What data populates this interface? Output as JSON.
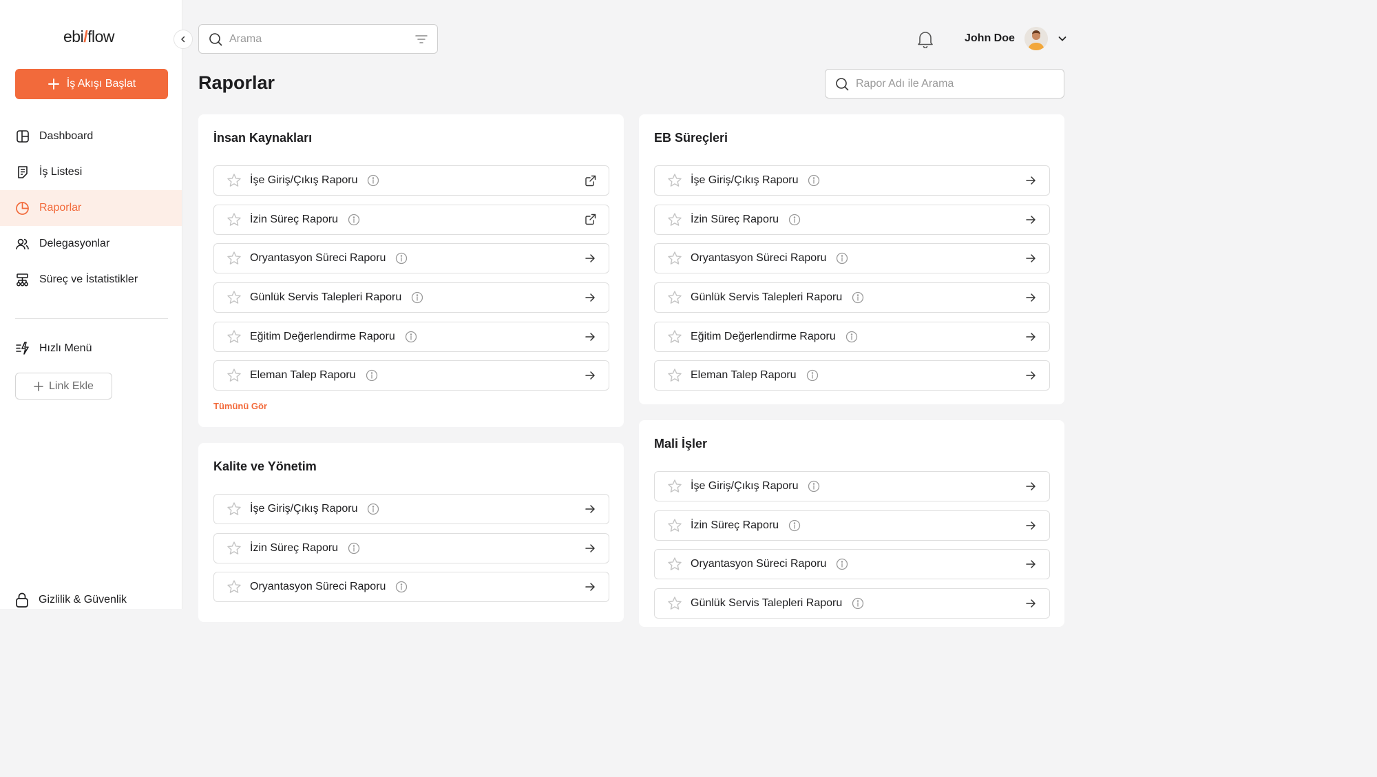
{
  "brand": {
    "logo_left": "ebi",
    "logo_slash": "/",
    "logo_right": "flow"
  },
  "sidebar": {
    "start_button": "İş Akışı Başlat",
    "items": [
      {
        "label": "Dashboard",
        "icon": "dashboard-icon",
        "active": false
      },
      {
        "label": "İş Listesi",
        "icon": "task-list-icon",
        "active": false
      },
      {
        "label": "Raporlar",
        "icon": "pie-chart-icon",
        "active": true
      },
      {
        "label": "Delegasyonlar",
        "icon": "users-icon",
        "active": false
      },
      {
        "label": "Süreç ve İstatistikler",
        "icon": "hierarchy-icon",
        "active": false
      }
    ],
    "quick_menu": "Hızlı Menü",
    "link_add": "Link Ekle",
    "privacy": "Gizlilik & Güvenlik"
  },
  "header": {
    "search_placeholder": "Arama",
    "user_name": "John Doe"
  },
  "page": {
    "title": "Raporlar",
    "report_search_placeholder": "Rapor Adı ile Arama"
  },
  "colors": {
    "accent": "#f26a3b",
    "accent_light": "#fdeee7",
    "background": "#f4f4f5"
  },
  "cards": {
    "hr": {
      "title": "İnsan Kaynakları",
      "see_all": "Tümünü Gör",
      "reports": [
        {
          "label": "İşe Giriş/Çıkış Raporu",
          "action": "external-link-icon"
        },
        {
          "label": "İzin Süreç Raporu",
          "action": "external-link-icon"
        },
        {
          "label": "Oryantasyon Süreci Raporu",
          "action": "arrow-right-icon"
        },
        {
          "label": "Günlük Servis Talepleri Raporu",
          "action": "arrow-right-icon"
        },
        {
          "label": "Eğitim Değerlendirme Raporu",
          "action": "arrow-right-icon"
        },
        {
          "label": "Eleman Talep Raporu",
          "action": "arrow-right-icon"
        }
      ]
    },
    "eb": {
      "title": "EB Süreçleri",
      "reports": [
        {
          "label": "İşe Giriş/Çıkış Raporu",
          "action": "arrow-right-icon"
        },
        {
          "label": "İzin Süreç Raporu",
          "action": "arrow-right-icon"
        },
        {
          "label": "Oryantasyon Süreci Raporu",
          "action": "arrow-right-icon"
        },
        {
          "label": "Günlük Servis Talepleri Raporu",
          "action": "arrow-right-icon"
        },
        {
          "label": "Eğitim Değerlendirme Raporu",
          "action": "arrow-right-icon"
        },
        {
          "label": "Eleman Talep Raporu",
          "action": "arrow-right-icon"
        }
      ]
    },
    "quality": {
      "title": "Kalite ve Yönetim",
      "reports": [
        {
          "label": "İşe Giriş/Çıkış Raporu",
          "action": "arrow-right-icon"
        },
        {
          "label": "İzin Süreç Raporu",
          "action": "arrow-right-icon"
        },
        {
          "label": "Oryantasyon Süreci Raporu",
          "action": "arrow-right-icon"
        }
      ]
    },
    "finance": {
      "title": "Mali İşler",
      "reports": [
        {
          "label": "İşe Giriş/Çıkış Raporu",
          "action": "arrow-right-icon"
        },
        {
          "label": "İzin Süreç Raporu",
          "action": "arrow-right-icon"
        },
        {
          "label": "Oryantasyon Süreci Raporu",
          "action": "arrow-right-icon"
        },
        {
          "label": "Günlük Servis Talepleri Raporu",
          "action": "arrow-right-icon"
        }
      ]
    }
  }
}
